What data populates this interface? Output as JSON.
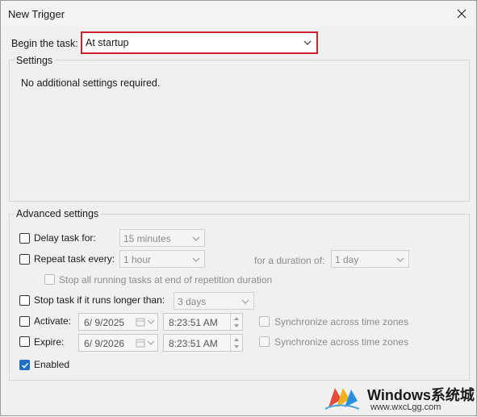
{
  "window": {
    "title": "New Trigger"
  },
  "begin": {
    "label": "Begin the task:",
    "value": "At startup"
  },
  "settings": {
    "title": "Settings",
    "message": "No additional settings required."
  },
  "advanced": {
    "title": "Advanced settings",
    "delay": {
      "label": "Delay task for:",
      "value": "15 minutes",
      "checked": false
    },
    "repeat": {
      "label": "Repeat task every:",
      "value": "1 hour",
      "checked": false,
      "duration_label": "for a duration of:",
      "duration_value": "1 day"
    },
    "stop_running": {
      "label": "Stop all running tasks at end of repetition duration"
    },
    "stop_longer": {
      "label": "Stop task if it runs longer than:",
      "value": "3 days"
    },
    "activate": {
      "label": "Activate:",
      "date": "6/ 9/2025",
      "time": "8:23:51 AM",
      "sync": "Synchronize across time zones"
    },
    "expire": {
      "label": "Expire:",
      "date": "6/ 9/2026",
      "time": "8:23:51 AM",
      "sync": "Synchronize across time zones"
    },
    "enabled": {
      "label": "Enabled",
      "checked": true
    }
  },
  "watermark": {
    "brand": "Windows系统城",
    "url": "www.wxcLgg.com"
  }
}
